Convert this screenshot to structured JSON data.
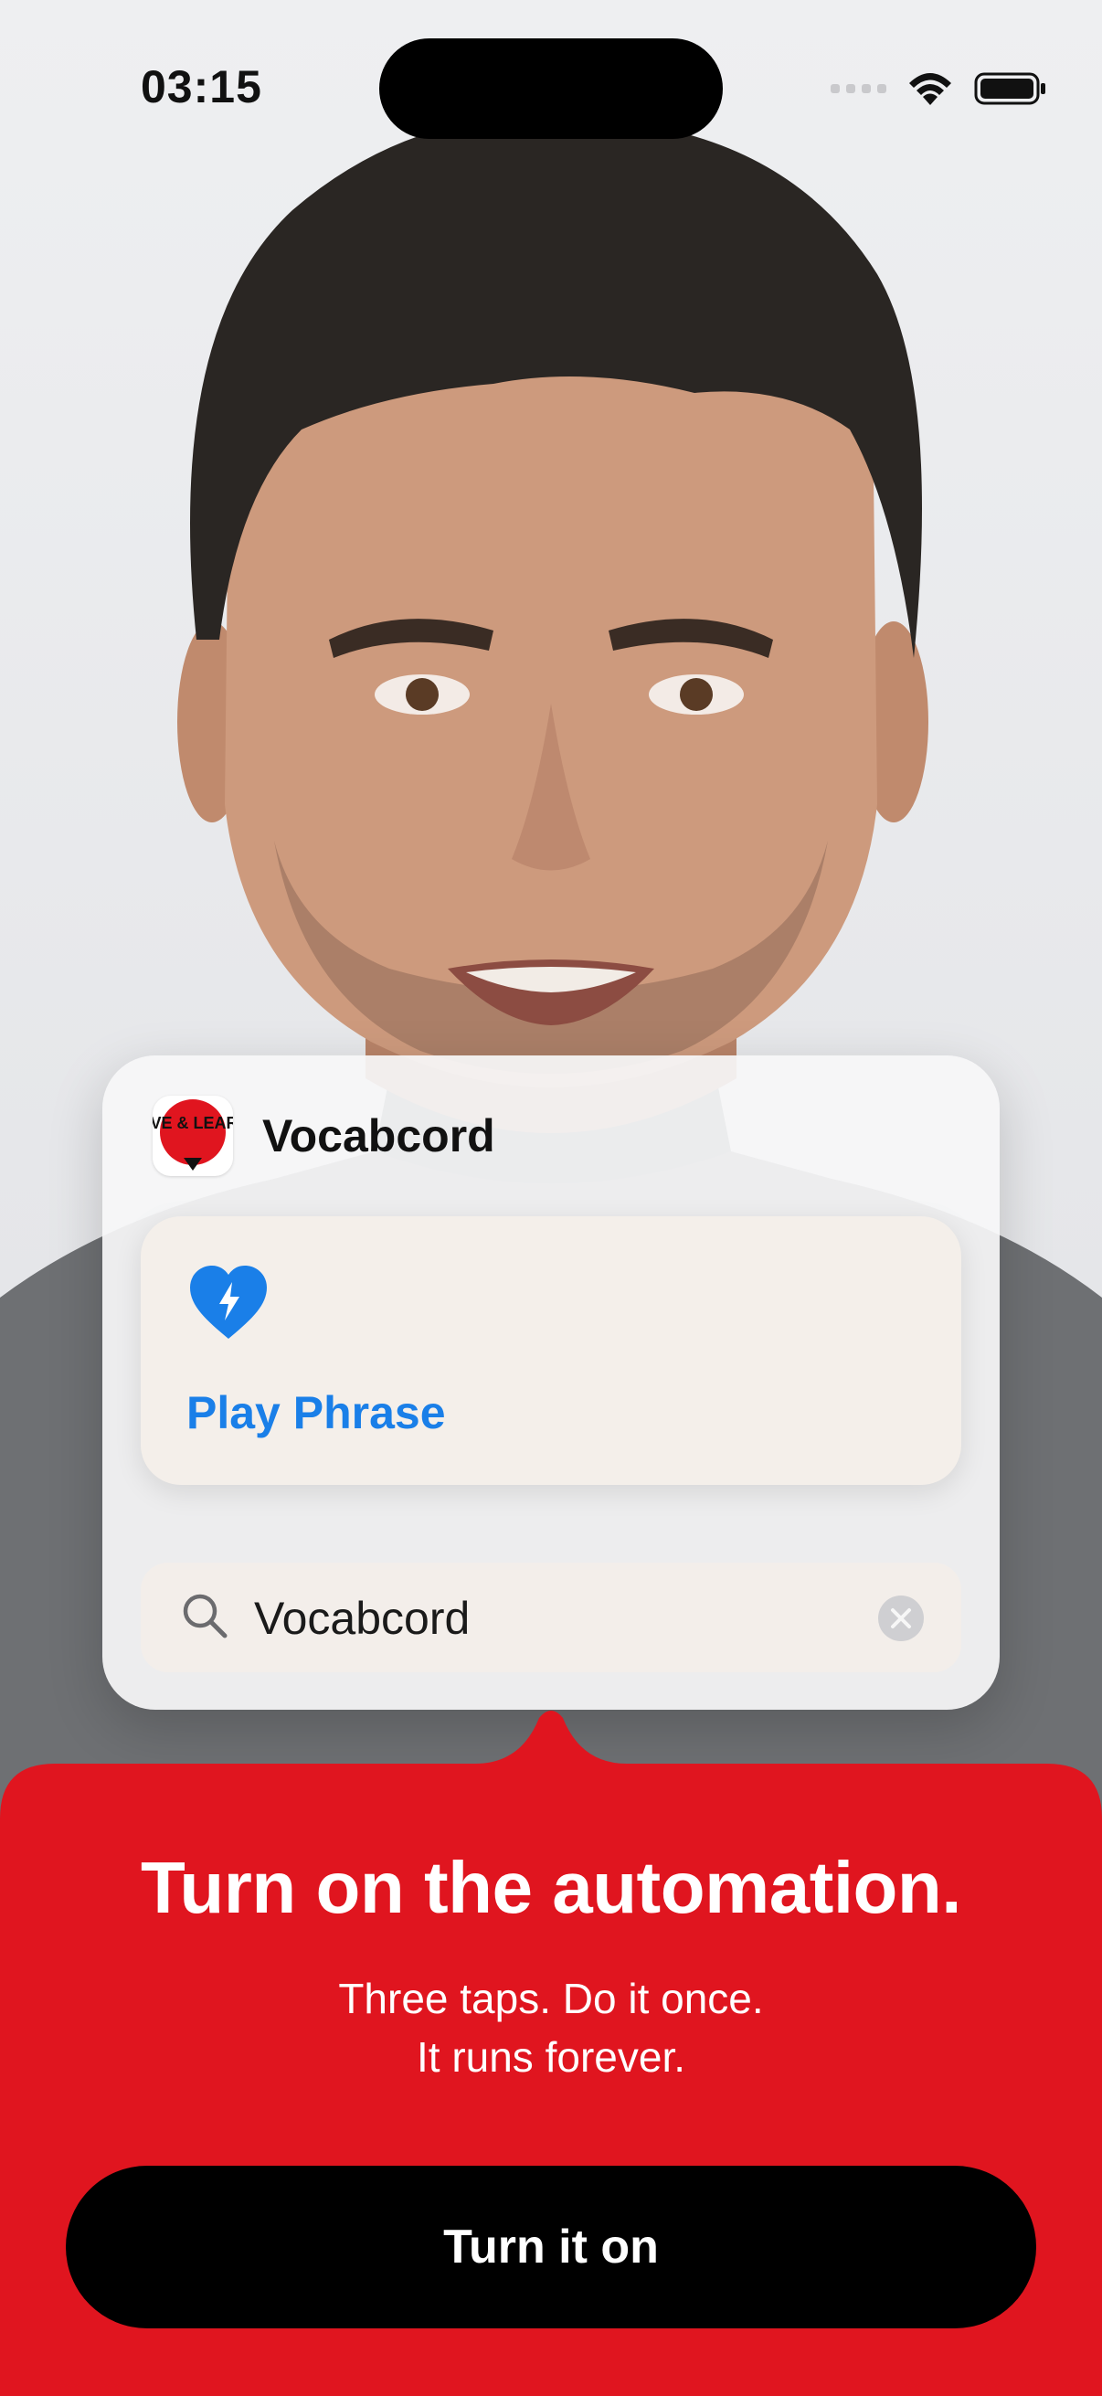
{
  "status_bar": {
    "time": "03:15",
    "icons": [
      "cellular-signal-icon",
      "wifi-icon",
      "battery-icon"
    ]
  },
  "widget": {
    "app_icon": "live-and-learn-logo",
    "app_icon_text": "LIVE & LEARN",
    "app_name": "Vocabcord",
    "action": {
      "icon": "heart-bolt-icon",
      "label": "Play Phrase"
    },
    "search": {
      "value": "Vocabcord"
    }
  },
  "sheet": {
    "title": "Turn on the automation.",
    "subtitle_line1": "Three taps. Do it once.",
    "subtitle_line2": "It runs forever.",
    "button_label": "Turn it on"
  },
  "colors": {
    "accent_red": "#e0151f",
    "action_blue": "#1a7fe8",
    "button_black": "#000000"
  }
}
